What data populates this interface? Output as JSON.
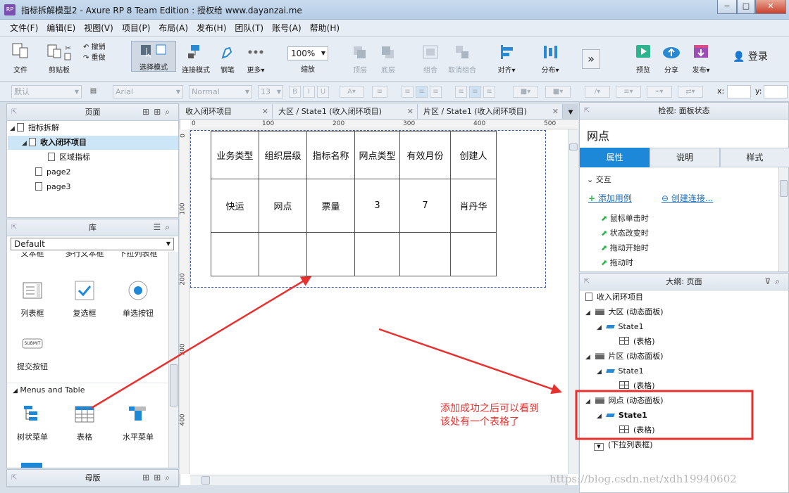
{
  "window": {
    "title": "指标拆解模型2 - Axure RP 8 Team Edition : 授权给 www.dayanzai.me",
    "app_icon": "RP",
    "buttons": [
      "−",
      "□",
      "✕"
    ]
  },
  "menu": [
    "文件(F)",
    "编辑(E)",
    "视图(V)",
    "项目(P)",
    "布局(A)",
    "发布(H)",
    "团队(T)",
    "账号(A)",
    "帮助(H)"
  ],
  "toolbar": {
    "file": "文件",
    "clipboard": "剪贴板",
    "undo": "撤销",
    "redo": "重做",
    "select_mode": "选择模式",
    "connect_mode": "连接模式",
    "pen": "钢笔",
    "more": "更多▾",
    "zoom_value": "100%",
    "zoom_label": "缩放",
    "top": "顶层",
    "bottom": "底层",
    "group": "组合",
    "ungroup": "取消组合",
    "align": "对齐▾",
    "distribute": "分布▾",
    "preview": "预览",
    "share": "分享",
    "publish": "发布▾",
    "login": "登录"
  },
  "format": {
    "style": "默认",
    "font": "Arial",
    "weight": "Normal",
    "size": "13",
    "x_label": "x:",
    "y_label": "y:"
  },
  "pages_panel": {
    "title": "页面",
    "items": [
      {
        "label": "指标拆解",
        "level": 0,
        "expanded": true
      },
      {
        "label": "收入闭环项目",
        "level": 1,
        "expanded": true,
        "selected": true
      },
      {
        "label": "区域指标",
        "level": 2
      },
      {
        "label": "page2",
        "level": 1
      },
      {
        "label": "page3",
        "level": 1
      }
    ]
  },
  "library_panel": {
    "title": "库",
    "selected": "Default",
    "partial_row": [
      "文本框",
      "多行文本框",
      "下拉列表框"
    ],
    "row1": [
      "列表框",
      "复选框",
      "单选按钮"
    ],
    "row2": [
      "提交按钮"
    ],
    "submit_text": "SUBMIT",
    "section": "Menus and Table",
    "row3": [
      "树状菜单",
      "表格",
      "水平菜单"
    ]
  },
  "master_panel": {
    "title": "母版"
  },
  "tabs": [
    "收入闭环项目",
    "大区 / State1 (收入闭环项目)",
    "片区 / State1 (收入闭环项目)"
  ],
  "ruler": {
    "h": [
      "0",
      "100",
      "200",
      "300",
      "400",
      "500"
    ],
    "v": [
      "0",
      "100",
      "200",
      "300",
      "400"
    ]
  },
  "table": {
    "headers": [
      "业务类型",
      "组织层级",
      "指标名称",
      "网点类型",
      "有效月份",
      "创建人"
    ],
    "row1": [
      "快运",
      "网点",
      "票量",
      "3",
      "7",
      "肖丹华"
    ],
    "row2": [
      "",
      "",
      "",
      "",
      "",
      ""
    ]
  },
  "inspector": {
    "header": "检视: 面板状态",
    "name": "网点",
    "tabs": [
      "属性",
      "说明",
      "样式"
    ],
    "interaction": "交互",
    "add_case": "添加用例",
    "create_link": "创建连接...",
    "events": [
      "鼠标单击时",
      "状态改变时",
      "拖动开始时",
      "拖动时"
    ]
  },
  "outline": {
    "header": "大纲: 页面",
    "page": "收入闭环项目",
    "items": [
      {
        "label": "大区 (动态面板)",
        "type": "panel"
      },
      {
        "label": "State1",
        "type": "state"
      },
      {
        "label": "(表格)",
        "type": "table"
      },
      {
        "label": "片区 (动态面板)",
        "type": "panel"
      },
      {
        "label": "State1",
        "type": "state"
      },
      {
        "label": "(表格)",
        "type": "table"
      },
      {
        "label": "网点 (动态面板)",
        "type": "panel"
      },
      {
        "label": "State1",
        "type": "state"
      },
      {
        "label": "(表格)",
        "type": "table"
      },
      {
        "label": "(下拉列表框)",
        "type": "dropdown"
      }
    ]
  },
  "annotation": {
    "line1": "添加成功之后可以看到",
    "line2": "该处有一个表格了",
    "color": "#e8312f"
  },
  "watermark": "https://blog.csdn.net/xdh19940602"
}
